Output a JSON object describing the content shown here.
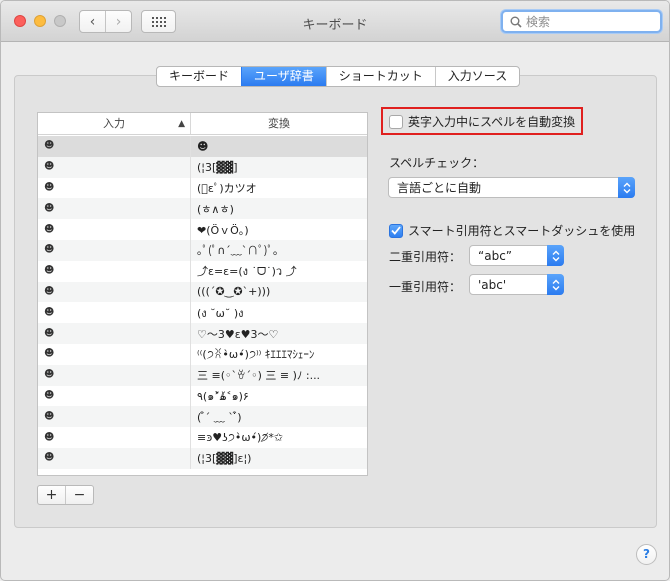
{
  "window": {
    "title": "キーボード",
    "search_placeholder": "検索"
  },
  "tabs": [
    {
      "label": "キーボード",
      "active": false
    },
    {
      "label": "ユーザ辞書",
      "active": true
    },
    {
      "label": "ショートカット",
      "active": false
    },
    {
      "label": "入力ソース",
      "active": false
    }
  ],
  "table": {
    "col_input": "入力",
    "col_convert": "変換",
    "rows": [
      {
        "input": "☻",
        "output": "☻",
        "selected": true
      },
      {
        "input": "☻",
        "output": "(¦3[▓▓]"
      },
      {
        "input": "☻",
        "output": "(ﾟεﾟ)カツオ"
      },
      {
        "input": "☻",
        "output": "(ㅎ∧ㅎ)"
      },
      {
        "input": "☻",
        "output": "❤(ӦｖӦ｡)"
      },
      {
        "input": "☻",
        "output": "｡ﾟ(ﾟ∩´﹏`∩ﾟ)ﾟ｡"
      },
      {
        "input": "☻",
        "output": "⤴ε=ε=(ง ˙ᗜ˙)ว ⤴"
      },
      {
        "input": "☻",
        "output": "(((´✪‿✪`+)))"
      },
      {
        "input": "☻",
        "output": "(ง ˘ω˘ )ง"
      },
      {
        "input": "☻",
        "output": "♡〜3♥ε♥3〜♡"
      },
      {
        "input": "☻",
        "output": "⁽⁽(੭ꐦ•̀ω•́)੭⁾⁾ ｷｴｴｴﾏｼｪｰﾝ"
      },
      {
        "input": "☻",
        "output": "三 ≡(◦`ꈊ´◦)  三 ≡ )ﾉ :..."
      },
      {
        "input": "☻",
        "output": "٩(๑˃̌ۿ˂̌๑)۶"
      },
      {
        "input": "☻",
        "output": "( ͒´ ﹏ ` ͒)"
      },
      {
        "input": "☻",
        "output": "≡ͽ♥ʖ੭•̀ω•́)੭̸*✩"
      },
      {
        "input": "☻",
        "output": "(¦3[▓▓]ε¦)"
      }
    ]
  },
  "controls": {
    "add": "+",
    "remove": "−"
  },
  "options": {
    "auto_spell_label": "英字入力中にスペルを自動変換",
    "auto_spell_checked": false,
    "spell_check_label": "スペルチェック：",
    "spell_check_value": "言語ごとに自動",
    "smart_quotes_label": "スマート引用符とスマートダッシュを使用",
    "smart_quotes_checked": true,
    "double_quote_label": "二重引用符：",
    "double_quote_value": "“abc”",
    "single_quote_label": "一重引用符：",
    "single_quote_value": "'abc'"
  },
  "help": "?",
  "colors": {
    "accent": "#2b7bf0",
    "highlight_border": "#e0201f"
  }
}
